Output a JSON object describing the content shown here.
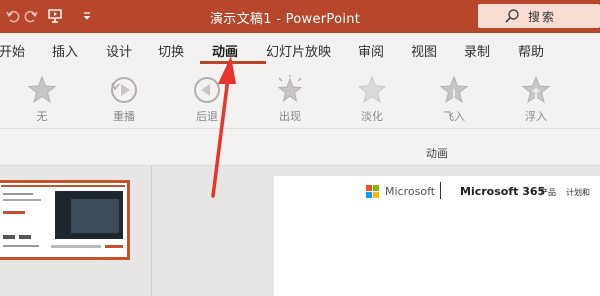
{
  "titlebar": {
    "title": "演示文稿1  -  PowerPoint",
    "search_label": "搜索",
    "icons": [
      "undo-icon",
      "redo-icon",
      "present-from-start-icon",
      "customize-quick-access-icon",
      "search-icon"
    ]
  },
  "tabs": [
    {
      "label": "开始",
      "active": false
    },
    {
      "label": "插入",
      "active": false
    },
    {
      "label": "设计",
      "active": false
    },
    {
      "label": "切换",
      "active": false
    },
    {
      "label": "动画",
      "active": true
    },
    {
      "label": "幻灯片放映",
      "active": false
    },
    {
      "label": "审阅",
      "active": false
    },
    {
      "label": "视图",
      "active": false
    },
    {
      "label": "录制",
      "active": false
    },
    {
      "label": "帮助",
      "active": false
    }
  ],
  "animations": [
    {
      "label": "无",
      "icon": "star-none-icon"
    },
    {
      "label": "重播",
      "icon": "replay-icon"
    },
    {
      "label": "后退",
      "icon": "back-icon"
    },
    {
      "label": "出现",
      "icon": "appear-star-icon"
    },
    {
      "label": "淡化",
      "icon": "fade-star-icon"
    },
    {
      "label": "飞入",
      "icon": "fly-in-star-icon"
    },
    {
      "label": "浮入",
      "icon": "float-in-star-icon"
    }
  ],
  "ribbon_group_label": "动画",
  "slide": {
    "brand": "Microsoft",
    "product": "Microsoft 365",
    "nav_products": "产品",
    "nav_plans": "计划和"
  },
  "colors": {
    "accent": "#b7472a",
    "search_bg": "#f7ddd4",
    "arrow": "#e8342c"
  }
}
